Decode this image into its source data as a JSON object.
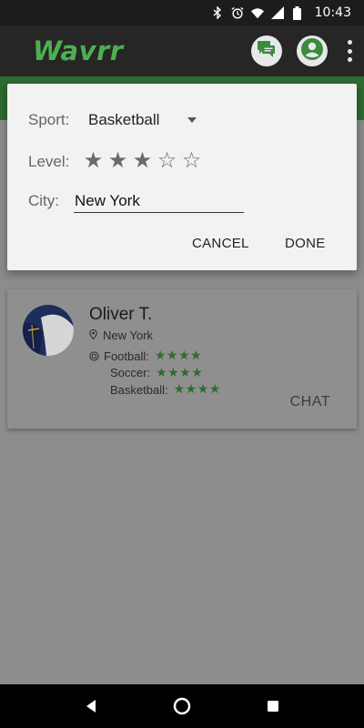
{
  "status_bar": {
    "time": "10:43",
    "icons": [
      "bluetooth-icon",
      "alarm-icon",
      "wifi-icon",
      "signal-icon",
      "battery-icon"
    ]
  },
  "app_bar": {
    "title": "Wavrr",
    "actions": [
      "chat-icon",
      "account-icon",
      "more-vert-icon"
    ]
  },
  "dialog": {
    "sport_label": "Sport:",
    "sport_value": "Basketball",
    "level_label": "Level:",
    "level_rating": 3,
    "level_max": 5,
    "city_label": "City:",
    "city_value": "New York",
    "cancel_label": "CANCEL",
    "done_label": "DONE"
  },
  "player_card": {
    "name": "Oliver T.",
    "location": "New York",
    "sports": [
      {
        "name": "Football:",
        "rating": 4
      },
      {
        "name": "Soccer:",
        "rating": 4
      },
      {
        "name": "Basketball:",
        "rating": 4
      }
    ],
    "chat_label": "CHAT"
  },
  "colors": {
    "brand_green": "#4caf50",
    "dark_green": "#2e6b31",
    "scrim": "#8c8c8c"
  }
}
